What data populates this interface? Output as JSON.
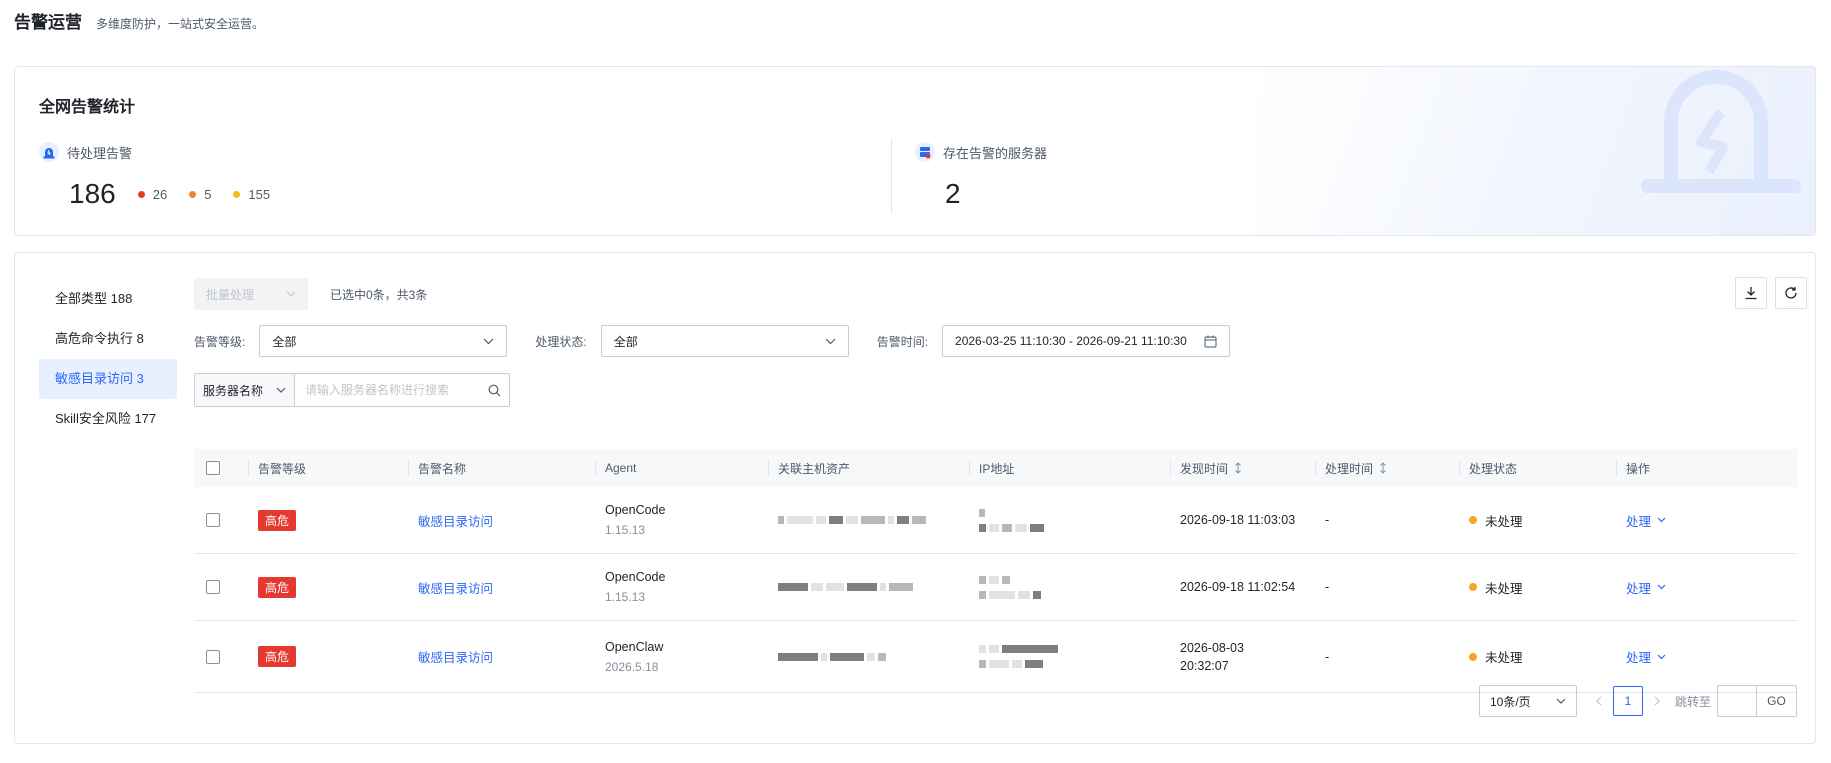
{
  "header": {
    "title": "告警运营",
    "subtitle": "多维度防护，一站式安全运营。"
  },
  "stats": {
    "title": "全网告警统计",
    "pending": {
      "label": "待处理告警",
      "total": "186",
      "breakdown": [
        {
          "value": "26",
          "color": "#e5382e"
        },
        {
          "value": "5",
          "color": "#f5832b"
        },
        {
          "value": "155",
          "color": "#f7ba1e"
        }
      ]
    },
    "servers": {
      "label": "存在告警的服务器",
      "value": "2"
    }
  },
  "sidebar": {
    "items": [
      {
        "label": "全部类型 188",
        "active": false
      },
      {
        "label": "高危命令执行 8",
        "active": false
      },
      {
        "label": "敏感目录访问 3",
        "active": true
      },
      {
        "label": "Skill安全风险 177",
        "active": false
      }
    ]
  },
  "toolbar": {
    "batch_label": "批量处理",
    "selection_info": "已选中0条，共3条"
  },
  "filters": {
    "level_label": "告警等级:",
    "level_value": "全部",
    "status_label": "处理状态:",
    "status_value": "全部",
    "time_label": "告警时间:",
    "time_value": "2026-03-25 11:10:30 - 2026-09-21 11:10:30"
  },
  "search": {
    "type": "服务器名称",
    "placeholder": "请输入服务器名称进行搜索"
  },
  "table": {
    "columns": [
      "告警等级",
      "告警名称",
      "Agent",
      "关联主机资产",
      "IP地址",
      "发现时间",
      "处理时间",
      "处理状态",
      "操作"
    ],
    "rows": [
      {
        "level": "高危",
        "name": "敏感目录访问",
        "agent": "OpenCode",
        "agent_version": "1.15.13",
        "found_time": "2026-09-18 11:03:03",
        "found_time_date": "",
        "found_time_clock": "",
        "handle_time": "-",
        "status": "未处理",
        "action": "处理"
      },
      {
        "level": "高危",
        "name": "敏感目录访问",
        "agent": "OpenCode",
        "agent_version": "1.15.13",
        "found_time": "2026-09-18 11:02:54",
        "found_time_date": "",
        "found_time_clock": "",
        "handle_time": "-",
        "status": "未处理",
        "action": "处理"
      },
      {
        "level": "高危",
        "name": "敏感目录访问",
        "agent": "OpenClaw",
        "agent_version": "2026.5.18",
        "found_time": "",
        "found_time_date": "2026-08-03",
        "found_time_clock": "20:32:07",
        "handle_time": "-",
        "status": "未处理",
        "action": "处理"
      }
    ]
  },
  "pagination": {
    "page_size": "10条/页",
    "current_page": "1",
    "jump_label": "跳转至",
    "go_label": "GO"
  },
  "colors": {
    "accent": "#2b67f6",
    "danger": "#e5382e",
    "warning": "#f5a623"
  },
  "icons": [
    "alarm-icon",
    "server-icon",
    "download-icon",
    "refresh-icon",
    "calendar-icon",
    "search-icon",
    "chevron-down-icon",
    "sort-icon"
  ]
}
